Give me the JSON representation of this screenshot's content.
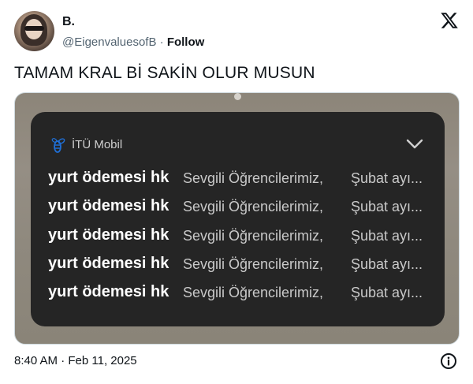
{
  "author": {
    "display_name": "B.",
    "handle": "@EigenvaluesofB",
    "separator": " · ",
    "follow_label": "Follow"
  },
  "tweet": {
    "text": "TAMAM KRAL Bİ SAKİN OLUR MUSUN",
    "timestamp": "8:40 AM · Feb 11, 2025"
  },
  "media": {
    "app_name": "İTÜ Mobil",
    "notifications": [
      {
        "subject": "yurt ödemesi hk",
        "body": "Sevgili Öğrencilerimiz,",
        "tail": "Şubat ayı..."
      },
      {
        "subject": "yurt ödemesi hk",
        "body": "Sevgili Öğrencilerimiz,",
        "tail": "Şubat ayı..."
      },
      {
        "subject": "yurt ödemesi hk",
        "body": "Sevgili Öğrencilerimiz,",
        "tail": "Şubat ayı..."
      },
      {
        "subject": "yurt ödemesi hk",
        "body": "Sevgili Öğrencilerimiz,",
        "tail": "Şubat ayı..."
      },
      {
        "subject": "yurt ödemesi hk",
        "body": "Sevgili Öğrencilerimiz,",
        "tail": "Şubat ayı..."
      }
    ]
  },
  "icons": {
    "platform_logo": "x-logo-icon",
    "app_logo": "itu-bee-icon",
    "expand": "chevron-down-icon",
    "info": "info-icon"
  },
  "colors": {
    "text_primary": "#0f1419",
    "text_secondary": "#536471",
    "notification_card": "#252525",
    "app_logo_blue": "#1f6fd6"
  }
}
